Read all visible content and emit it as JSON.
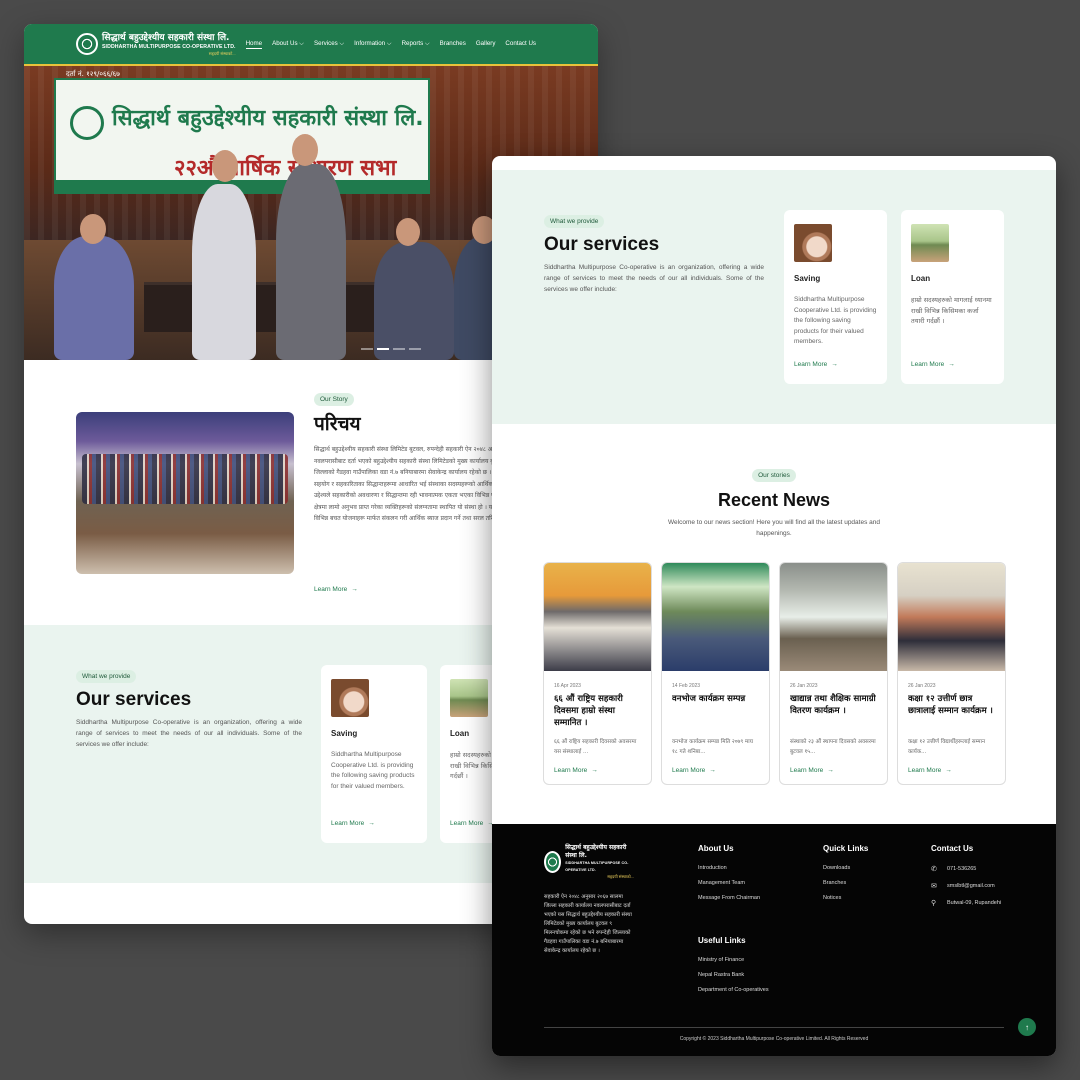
{
  "brand": {
    "name_np": "सिद्धार्थ बहुउद्देश्यीय सहकारी संस्था लि.",
    "name_en": "SIDDHARTHA MULTIPURPOSE CO-OPERATIVE LTD.",
    "tagline": "सहृदयी संस्थाको...",
    "accent": "#1f7a4d"
  },
  "nav": {
    "items": [
      {
        "label": "Home",
        "active": true
      },
      {
        "label": "About Us",
        "dropdown": true
      },
      {
        "label": "Services",
        "dropdown": true
      },
      {
        "label": "Information",
        "dropdown": true
      },
      {
        "label": "Reports",
        "dropdown": true
      },
      {
        "label": "Branches"
      },
      {
        "label": "Gallery"
      },
      {
        "label": "Contact Us"
      }
    ]
  },
  "hero": {
    "reg_no": "दर्ता नं. १२९/०६६/६७",
    "banner_title": "सिद्धार्थ बहुउद्देश्यीय सहकारी संस्था लि.",
    "banner_subtitle": "२२औं वार्षिक साधारण सभा"
  },
  "story": {
    "badge": "Our Story",
    "title": "परिचय",
    "body": "सिद्धार्थ बहुउद्देश्यीय सहकारी संस्था लिमिटेड बुटवल, रुपन्देही सहकारी ऐन २०४८ अनुसार २०६७ सालमा जिल्ला सहकारी कार्यालय नवलपरासीबाट दर्ता भएको बहुउद्देश्यीय सहकारी संस्था लिमिटेडको मुख्य कार्यालय बुटवल ९ मिलनचोकमा रहेको छ भने रुपन्देही जिल्लाको गैडहवा गाउँपालिका वडा नं.७ बनियाबारमा सेवाकेन्द्र कार्यालय रहेको छ । जनसमुदायबीच सहानुभूतिको भावना, पारस्परिक सहयोग र सहकारिताका सिद्धान्तहरूमा आधारित भई संस्थाका सदस्यहरूको आर्थिक तथा सामाजिक जीवन-स्तर अभिवृद्धि गर्ने उद्देश्यले सहकारीको अवधारणा र सिद्धान्तमा रही भावनात्मक एकता भएका विभिन्न पेशाका व्यक्तिहरू, शिक्षक, कर्मचारी तथा बैंकिङ्ग क्षेत्रमा लामो अनुभव प्राप्त गरेका व्यक्तिहरूको संलग्नतामा स्थापित यो संस्था हो । यस संस्थाले सदस्यहरूमा छरिएर रहेको पूँजीलाई विभिन्न बचत योजनाहरू मार्फत संकलन गरी आर्थिक ब्याज प्रदान गर्ने तथा सरल तरिकाबाट छिटो छरितो रूपमा कर्जा प्रवाह ग...",
    "learn_more": "Learn More"
  },
  "services": {
    "badge": "What we provide",
    "title": "Our services",
    "desc": "Siddhartha Multipurpose Co-operative is an organization, offering a wide range of services to meet the needs of our all individuals. Some of the services we offer include:",
    "cards": [
      {
        "title": "Saving",
        "text": "Siddhartha Multipurpose Cooperative Ltd. is providing the following saving products for their valued members.",
        "learn_more": "Learn More",
        "icon": "piggy-bank-photo"
      },
      {
        "title": "Loan",
        "text": "हाम्रो सदस्यहरुको मागलाई ध्यानमा राखी विभिन्न किसिमका कर्जा तयारी गर्दछौं ।",
        "learn_more": "Learn More",
        "icon": "loan-photo"
      }
    ]
  },
  "news": {
    "badge": "Our stories",
    "title": "Recent News",
    "desc": "Welcome to our news section! Here you will find all the latest updates and happenings.",
    "items": [
      {
        "date": "16 Apr 2023",
        "title": "६६ औं राष्ट्रिय सहकारी दिवसमा हाम्रो संस्था सम्मानित ।",
        "excerpt": "६६ औं राष्ट्रिय सहकारी दिवसको अवसरमा यस संस्थालाई ...",
        "learn_more": "Learn More"
      },
      {
        "date": "14 Feb 2023",
        "title": "वनभोज कार्यक्रम सम्पन्न",
        "excerpt": "वनभोज कार्यक्रम सम्पन्न मिति २०७९ माघ १८ गते शनिबा...",
        "learn_more": "Learn More"
      },
      {
        "date": "26 Jan 2023",
        "title": "खाद्यान्न तथा शैक्षिक सामाग्री वितरण कार्यक्रम ।",
        "excerpt": "संस्थाको २३ औं स्थापना दिवसको अवसरमा बुटवल १५...",
        "learn_more": "Learn More"
      },
      {
        "date": "26 Jan 2023",
        "title": "कक्षा १२ उत्तीर्ण छात्र छात्रालाई सम्मान कार्यक्रम ।",
        "excerpt": "कक्षा १२ उत्तीर्ण विद्यार्थीहरूलाई सम्मान कार्यक...",
        "learn_more": "Learn More"
      }
    ]
  },
  "footer": {
    "about_text": "सहकारी ऐन २०४८ अनुसार २०६७ सालमा जिल्ला सहकारी कार्यालय नवलपरासीबाट दर्ता भएको यस सिद्धार्थ बहुउद्देश्यीय सहकारी संस्था लिमिटेडको मुख्य कार्यालय बुटवल ९ मिलनचोकमा रहेको छ भने रुपन्देही जिल्लाको गैडहवा गाउँपालिका वडा नं.७ बनियाबारमा सेवाकेन्द्र कार्यालय रहेको छ ।",
    "about_title": "About Us",
    "about_links": [
      "Introduction",
      "Management Team",
      "Message From Chairman"
    ],
    "quick_title": "Quick Links",
    "quick_links": [
      "Downloads",
      "Branches",
      "Notices"
    ],
    "contact_title": "Contact Us",
    "phone": "071-536265",
    "email": "smslbtl@gmail.com",
    "address": "Butwal-09, Rupandehi",
    "useful_title": "Useful Links",
    "useful_links": [
      "Ministry of Finance",
      "Nepal Rastra Bank",
      "Department of Co-operatives"
    ],
    "copyright": "Copyright © 2023 Siddhartha Multipurpose Co-operative Limited. All Rights Reserved"
  }
}
